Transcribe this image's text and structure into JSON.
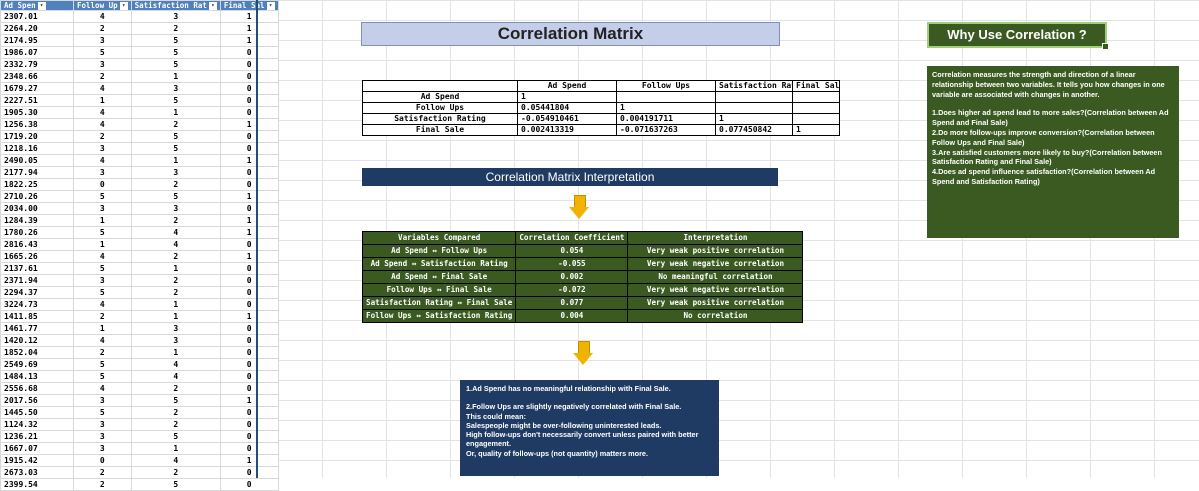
{
  "sheet": {
    "headers": [
      "Ad Spen",
      "Follow Up",
      "Satisfaction Rat",
      "Final Sal"
    ],
    "rows": [
      [
        "2307.01",
        "4",
        "3",
        "1"
      ],
      [
        "2264.20",
        "2",
        "2",
        "1"
      ],
      [
        "2174.95",
        "3",
        "5",
        "1"
      ],
      [
        "1986.07",
        "5",
        "5",
        "0"
      ],
      [
        "2332.79",
        "3",
        "5",
        "0"
      ],
      [
        "2348.66",
        "2",
        "1",
        "0"
      ],
      [
        "1679.27",
        "4",
        "3",
        "0"
      ],
      [
        "2227.51",
        "1",
        "5",
        "0"
      ],
      [
        "1905.30",
        "4",
        "1",
        "0"
      ],
      [
        "1256.38",
        "4",
        "2",
        "1"
      ],
      [
        "1719.20",
        "2",
        "5",
        "0"
      ],
      [
        "1218.16",
        "3",
        "5",
        "0"
      ],
      [
        "2490.05",
        "4",
        "1",
        "1"
      ],
      [
        "2177.94",
        "3",
        "3",
        "0"
      ],
      [
        "1822.25",
        "0",
        "2",
        "0"
      ],
      [
        "2710.26",
        "5",
        "5",
        "1"
      ],
      [
        "2034.00",
        "3",
        "3",
        "0"
      ],
      [
        "1284.39",
        "1",
        "2",
        "1"
      ],
      [
        "1780.26",
        "5",
        "4",
        "1"
      ],
      [
        "2816.43",
        "1",
        "4",
        "0"
      ],
      [
        "1665.26",
        "4",
        "2",
        "1"
      ],
      [
        "2137.61",
        "5",
        "1",
        "0"
      ],
      [
        "2371.94",
        "3",
        "2",
        "0"
      ],
      [
        "2294.37",
        "5",
        "2",
        "0"
      ],
      [
        "3224.73",
        "4",
        "1",
        "0"
      ],
      [
        "1411.85",
        "2",
        "1",
        "1"
      ],
      [
        "1461.77",
        "1",
        "3",
        "0"
      ],
      [
        "1420.12",
        "4",
        "3",
        "0"
      ],
      [
        "1852.04",
        "2",
        "1",
        "0"
      ],
      [
        "2549.69",
        "5",
        "4",
        "0"
      ],
      [
        "1484.13",
        "5",
        "4",
        "0"
      ],
      [
        "2556.68",
        "4",
        "2",
        "0"
      ],
      [
        "2017.56",
        "3",
        "5",
        "1"
      ],
      [
        "1445.50",
        "5",
        "2",
        "0"
      ],
      [
        "1124.32",
        "3",
        "2",
        "0"
      ],
      [
        "1236.21",
        "3",
        "5",
        "0"
      ],
      [
        "1667.07",
        "3",
        "1",
        "0"
      ],
      [
        "1915.42",
        "0",
        "4",
        "1"
      ],
      [
        "2673.03",
        "2",
        "2",
        "0"
      ],
      [
        "2399.54",
        "2",
        "5",
        "0"
      ]
    ]
  },
  "title": "Correlation Matrix",
  "why_title": "Why Use Correlation ?",
  "why_text": [
    "Correlation measures the strength and direction of a linear relationship between two variables. It tells you how changes in one variable are associated with changes in another.",
    "",
    "1.Does higher ad spend lead to more sales?(Correlation between Ad Spend and Final Sale)",
    "2.Do more follow-ups improve conversion?(Correlation between Follow Ups and Final Sale)",
    "3.Are satisfied customers more likely to buy?(Correlation between Satisfaction Rating and Final Sale)",
    "4.Does ad spend influence satisfaction?(Correlation between Ad Spend and Satisfaction Rating)"
  ],
  "matrix": {
    "columns": [
      "Ad Spend",
      "Follow Ups",
      "Satisfaction Rating",
      "Final Sale"
    ],
    "rows": [
      {
        "label": "Ad Spend",
        "cells": [
          "1",
          "",
          "",
          ""
        ]
      },
      {
        "label": "Follow Ups",
        "cells": [
          "0.05441804",
          "1",
          "",
          ""
        ]
      },
      {
        "label": "Satisfaction Rating",
        "cells": [
          "-0.054910461",
          "0.004191711",
          "1",
          ""
        ]
      },
      {
        "label": "Final Sale",
        "cells": [
          "0.002413319",
          "-0.071637263",
          "0.077450842",
          "1"
        ]
      }
    ]
  },
  "interp_title": "Correlation Matrix Interpretation",
  "interp_table": {
    "headers": [
      "Variables Compared",
      "Correlation Coefficient",
      "Interpretation"
    ],
    "rows": [
      [
        "Ad Spend ↔ Follow Ups",
        "0.054",
        "Very weak positive correlation"
      ],
      [
        "Ad Spend ↔ Satisfaction Rating",
        "-0.055",
        "Very weak negative correlation"
      ],
      [
        "Ad Spend ↔ Final Sale",
        "0.002",
        "No meaningful correlation"
      ],
      [
        "Follow Ups ↔ Final Sale",
        "-0.072",
        "Very weak negative correlation"
      ],
      [
        "Satisfaction Rating ↔ Final Sale",
        "0.077",
        "Very weak positive correlation"
      ],
      [
        "Follow Ups ↔ Satisfaction Rating",
        "0.004",
        "No correlation"
      ]
    ]
  },
  "note_text": [
    "1.Ad Spend has no meaningful relationship with Final Sale.",
    "",
    "2.Follow Ups are slightly negatively correlated with Final Sale.",
    "This could mean:",
    "Salespeople might be over-following uninterested leads.",
    "High follow-ups don't necessarily convert unless paired with better engagement.",
    "Or, quality of follow-ups (not quantity) matters more."
  ],
  "colors": {
    "header_blue": "#4f81bd",
    "dark_green": "#3a5a22",
    "navy": "#1f3b63",
    "lavender": "#c5cee8",
    "arrow": "#f0b400"
  }
}
